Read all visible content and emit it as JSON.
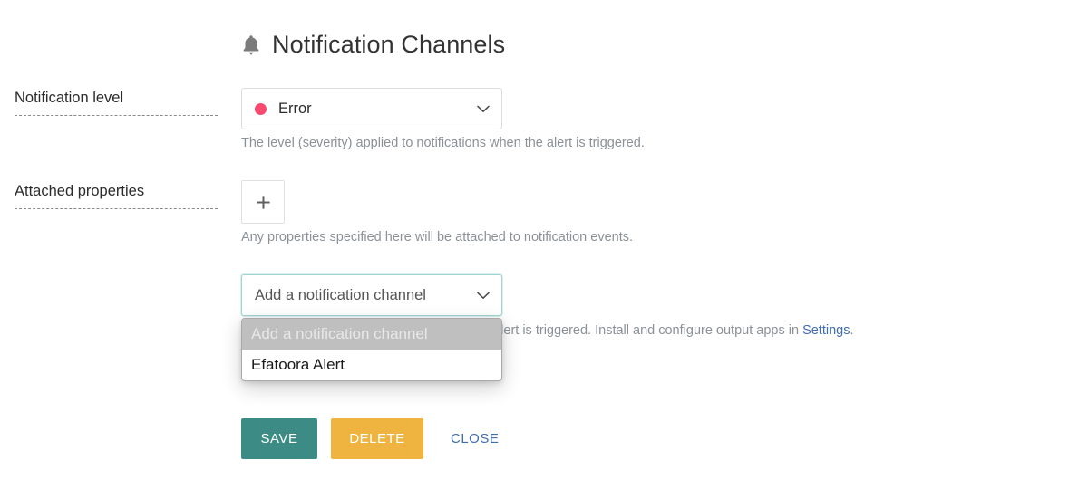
{
  "header": {
    "title": "Notification Channels",
    "icon": "bell-icon"
  },
  "fields": {
    "notification_level": {
      "label": "Notification level",
      "value": "Error",
      "dot_color": "#fa4a6f",
      "help": "The level (severity) applied to notifications when the alert is triggered."
    },
    "attached_properties": {
      "label": "Attached properties",
      "add_button_glyph": "+",
      "help": "Any properties specified here will be attached to notification events."
    },
    "notification_channel": {
      "value": "Add a notification channel",
      "help_prefix": "Output apps to send notifications when the alert is triggered. Install and configure output apps in ",
      "help_link": "Settings",
      "help_suffix": ".",
      "options": [
        {
          "label": "Add a notification channel",
          "selected": true
        },
        {
          "label": "Efatoora Alert",
          "selected": false
        }
      ]
    }
  },
  "actions": {
    "save": "SAVE",
    "delete": "DELETE",
    "close": "CLOSE"
  },
  "colors": {
    "save": "#3c8c85",
    "delete": "#efb33f",
    "link": "#3f6fb0",
    "error_dot": "#fa4a6f",
    "focus_border": "#9fd5d0"
  }
}
